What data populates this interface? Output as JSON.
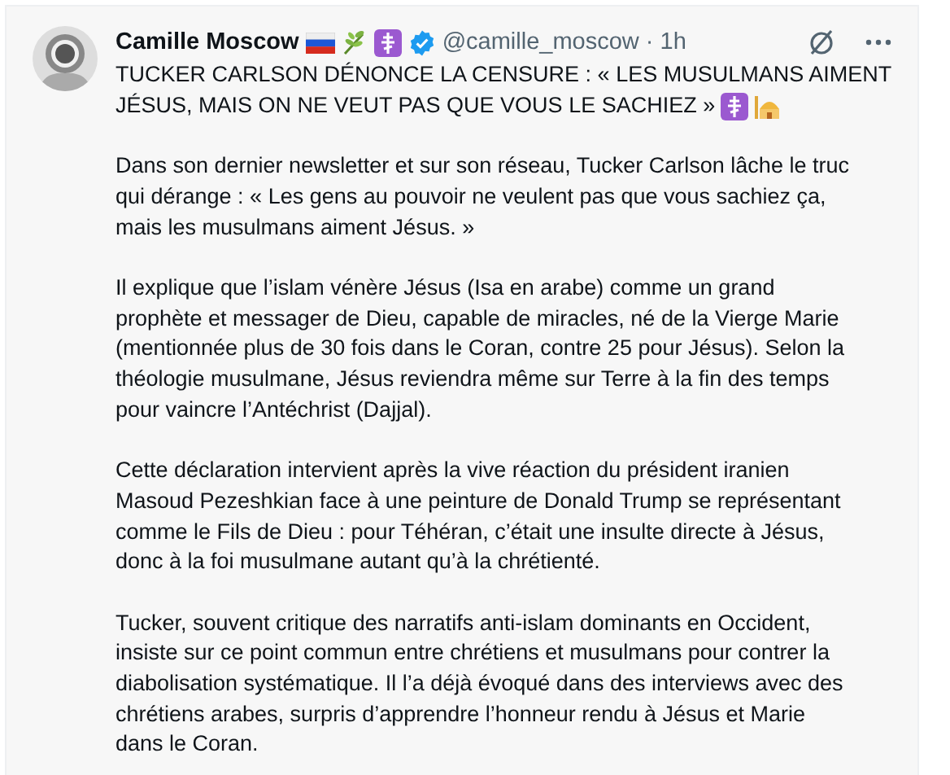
{
  "post": {
    "author_name": "Camille Moscow",
    "handle": "@camille_moscow",
    "separator": "·",
    "time": "1h",
    "name_badges": [
      {
        "kind": "flag"
      },
      {
        "kind": "herb"
      },
      {
        "kind": "cross"
      },
      {
        "kind": "verified"
      }
    ],
    "title_lines": [
      "TUCKER CARLSON DÉNONCE LA CENSURE : « LES MUSULMANS AIMENT",
      "JÉSUS, MAIS ON NE VEUT PAS QUE VOUS LE SACHIEZ »"
    ],
    "title_emojis": [
      {
        "kind": "cross"
      },
      {
        "kind": "mosque"
      }
    ],
    "paragraphs": [
      "Dans son dernier newsletter et sur son réseau, Tucker Carlson lâche le truc\nqui dérange : « Les gens au pouvoir ne veulent pas que vous sachiez ça,\nmais les musulmans aiment Jésus. »",
      "Il explique que l’islam vénère Jésus (Isa en arabe) comme un grand\nprophète et messager de Dieu, capable de miracles, né de la Vierge Marie\n(mentionnée plus de 30 fois dans le Coran, contre 25 pour Jésus). Selon la\nthéologie musulmane, Jésus reviendra même sur Terre à la fin des temps\npour vaincre l’Antéchrist (Dajjal).",
      "Cette déclaration intervient après la vive réaction du président iranien\nMasoud Pezeshkian face à une peinture de Donald Trump se représentant\ncomme le Fils de Dieu : pour Téhéran, c’était une insulte directe à Jésus,\ndonc à la foi musulmane autant qu’à la chrétienté.",
      "Tucker, souvent critique des narratifs anti-islam dominants en Occident,\ninsiste sur ce point commun entre chrétiens et musulmans pour contrer la\ndiabolisation systématique. Il l’a déjà évoqué dans des interviews avec des\nchrétiens arabes, surpris d’apprendre l’honneur rendu à Jésus et Marie\ndans le Coran."
    ]
  }
}
